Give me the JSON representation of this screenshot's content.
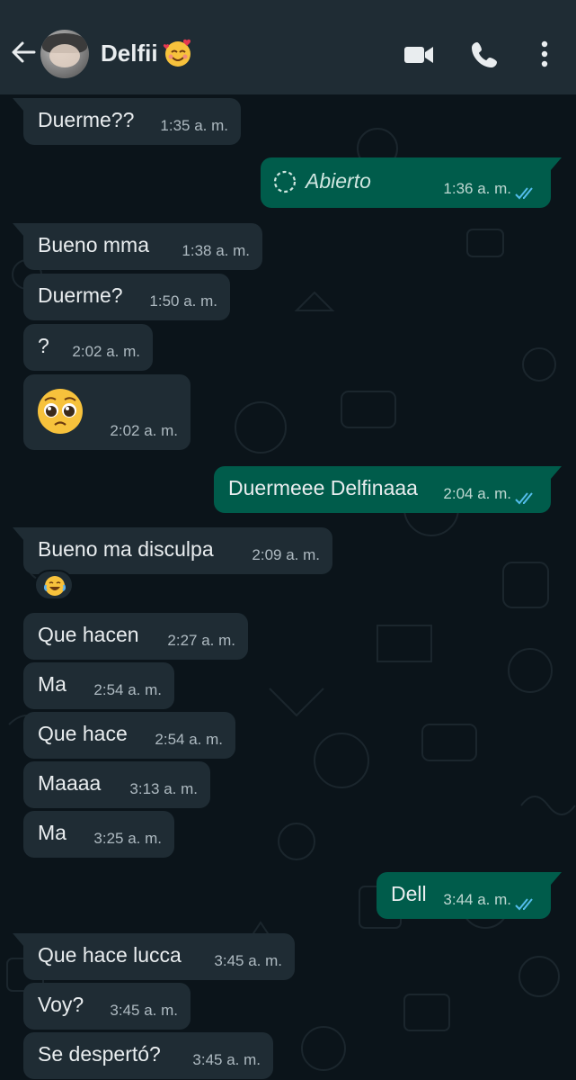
{
  "header": {
    "contact_name": "Delfii",
    "name_emoji": "smiling-face-with-hearts"
  },
  "messages": [
    {
      "id": "m1",
      "direction": "in",
      "text": "Duerme??",
      "time": "1:35 a. m."
    },
    {
      "id": "m2",
      "direction": "out",
      "type": "view-once",
      "text": "Abierto",
      "time": "1:36 a. m.",
      "status": "read"
    },
    {
      "id": "m3",
      "direction": "in",
      "text": "Bueno mma",
      "time": "1:38 a. m."
    },
    {
      "id": "m4",
      "direction": "in",
      "text": "Duerme?",
      "time": "1:50 a. m."
    },
    {
      "id": "m5",
      "direction": "in",
      "text": "?",
      "time": "2:02 a. m."
    },
    {
      "id": "m6",
      "direction": "in",
      "type": "emoji",
      "emoji": "pleading-face",
      "time": "2:02 a. m."
    },
    {
      "id": "m7",
      "direction": "out",
      "text": "Duermeee Delfinaaa",
      "time": "2:04 a. m.",
      "status": "read"
    },
    {
      "id": "m8",
      "direction": "in",
      "text": "Bueno ma disculpa",
      "time": "2:09 a. m.",
      "reaction": "face-with-tears-of-joy"
    },
    {
      "id": "m9",
      "direction": "in",
      "text": "Que hacen",
      "time": "2:27 a. m."
    },
    {
      "id": "m10",
      "direction": "in",
      "text": "Ma",
      "time": "2:54 a. m."
    },
    {
      "id": "m11",
      "direction": "in",
      "text": "Que hace",
      "time": "2:54 a. m."
    },
    {
      "id": "m12",
      "direction": "in",
      "text": "Maaaa",
      "time": "3:13 a. m."
    },
    {
      "id": "m13",
      "direction": "in",
      "text": "Ma",
      "time": "3:25 a. m."
    },
    {
      "id": "m14",
      "direction": "out",
      "text": "Dell",
      "time": "3:44 a. m.",
      "status": "read"
    },
    {
      "id": "m15",
      "direction": "in",
      "text": "Que hace lucca",
      "time": "3:45 a. m."
    },
    {
      "id": "m16",
      "direction": "in",
      "text": "Voy?",
      "time": "3:45 a. m."
    },
    {
      "id": "m17",
      "direction": "in",
      "text": "Se despertó?",
      "time": "3:45 a. m."
    }
  ],
  "colors": {
    "header_bg": "#1f2c34",
    "chat_bg": "#0b141a",
    "incoming_bubble": "#1f2c34",
    "outgoing_bubble": "#005c4b",
    "read_ticks": "#53bdeb"
  }
}
